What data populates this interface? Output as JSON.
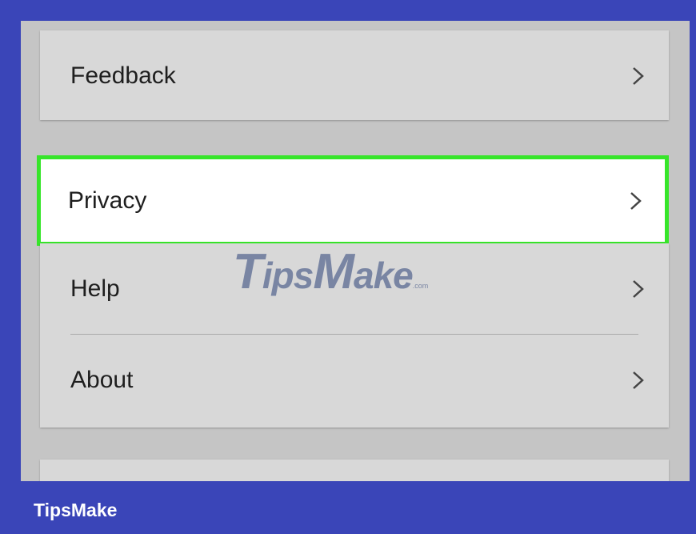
{
  "settings": {
    "items": [
      {
        "label": "Feedback"
      },
      {
        "label": "Privacy"
      },
      {
        "label": "Help"
      },
      {
        "label": "About"
      }
    ]
  },
  "watermark": {
    "big_t": "T",
    "ips": "ips",
    "big_m": "M",
    "ake": "ake",
    "com": ".com"
  },
  "footer": {
    "brand": "TipsMake"
  },
  "colors": {
    "highlight": "#37e52a",
    "frame": "#3a45b8"
  },
  "icons": {
    "chevron": "chevron-right-icon"
  }
}
